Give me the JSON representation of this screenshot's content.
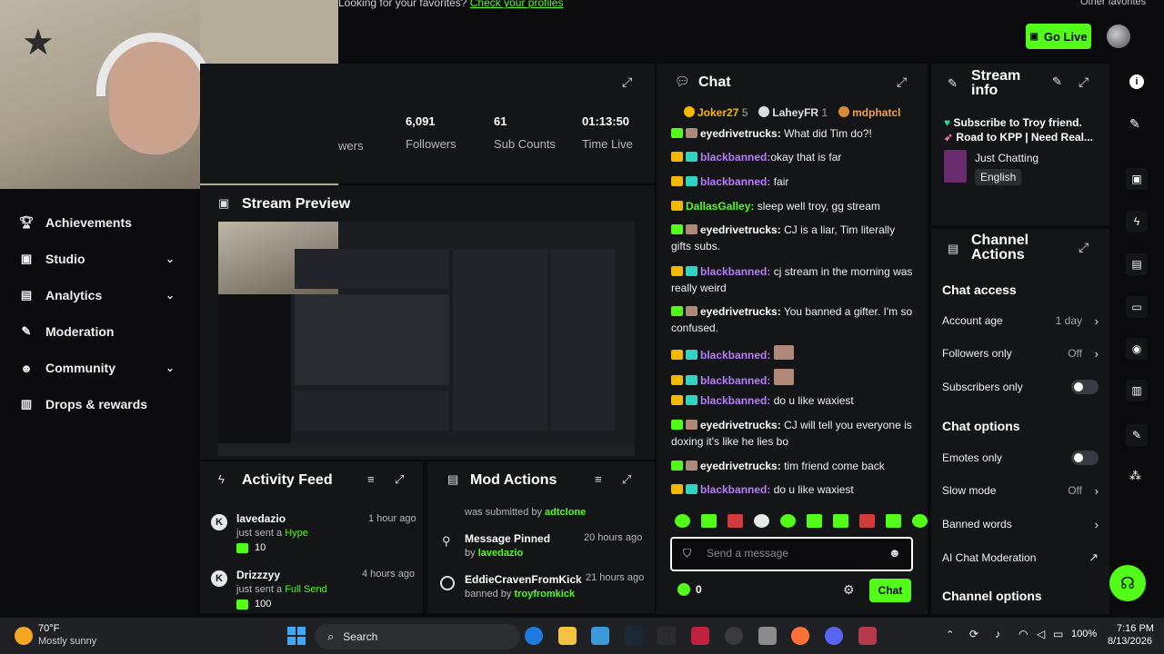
{
  "banner": {
    "text": "Looking for your favorites?",
    "link": "Check your profiles",
    "right_text": "Other favorites"
  },
  "topbar": {
    "go_live": "Go Live"
  },
  "sidebar": {
    "items": [
      {
        "label": "Achievements",
        "icon": "trophy-icon",
        "expandable": false
      },
      {
        "label": "Studio",
        "icon": "studio-icon",
        "expandable": true
      },
      {
        "label": "Analytics",
        "icon": "chart-icon",
        "expandable": true
      },
      {
        "label": "Moderation",
        "icon": "wrench-icon",
        "expandable": false
      },
      {
        "label": "Community",
        "icon": "users-icon",
        "expandable": true
      },
      {
        "label": "Drops & rewards",
        "icon": "gift-icon",
        "expandable": false
      }
    ]
  },
  "stats": {
    "items": [
      {
        "value": "",
        "label": "wers"
      },
      {
        "value": "6,091",
        "label": "Followers"
      },
      {
        "value": "61",
        "label": "Sub Counts"
      },
      {
        "value": "01:13:50",
        "label": "Time Live"
      }
    ]
  },
  "preview": {
    "title": "Stream Preview"
  },
  "activity": {
    "title": "Activity Feed",
    "items": [
      {
        "user": "lavedazio",
        "time": "1 hour ago",
        "action": "just sent a",
        "item": "Hype",
        "amount": "10"
      },
      {
        "user": "Drizzzyy",
        "time": "4 hours ago",
        "action": "just sent a",
        "item": "Full Send",
        "amount": "100"
      }
    ]
  },
  "modactions": {
    "title": "Mod Actions",
    "items": [
      {
        "title": "",
        "by_label": "was submitted by",
        "by": "adtclone",
        "time": ""
      },
      {
        "title": "Message Pinned",
        "by_label": "by",
        "by": "lavedazio",
        "time": "20 hours ago"
      },
      {
        "title": "EddieCravenFromKick",
        "by_label": "banned by",
        "by": "troyfromkick",
        "time": "21 hours ago"
      }
    ]
  },
  "chat": {
    "title": "Chat",
    "leaders": [
      {
        "name": "Joker27",
        "count": "5",
        "rank": "1"
      },
      {
        "name": "LaheyFR",
        "count": "1",
        "rank": "2"
      },
      {
        "name": "mdphatcl",
        "count": "",
        "rank": "3"
      }
    ],
    "messages": [
      {
        "user": "eyedrivetrucks:",
        "text": "What did Tim do?!"
      },
      {
        "user": "blackbanned:",
        "text": "okay that is far"
      },
      {
        "user": "blackbanned:",
        "text": "fair"
      },
      {
        "user": "DallasGalley:",
        "text": "sleep well troy, gg stream"
      },
      {
        "user": "eyedrivetrucks:",
        "text": "CJ is a liar, Tim literally gifts subs."
      },
      {
        "user": "blackbanned:",
        "text": "cj stream in the morning was really weird"
      },
      {
        "user": "eyedrivetrucks:",
        "text": "You banned a gifter. I'm so confused."
      },
      {
        "user": "blackbanned:",
        "text": ""
      },
      {
        "user": "blackbanned:",
        "text": ""
      },
      {
        "user": "blackbanned:",
        "text": "do u like waxiest"
      },
      {
        "user": "eyedrivetrucks:",
        "text": "CJ will tell you everyone is doxing it's like he lies bo"
      },
      {
        "user": "eyedrivetrucks:",
        "text": "tim friend come back"
      },
      {
        "user": "blackbanned:",
        "text": "do u like waxiest"
      }
    ],
    "input_placeholder": "Send a message",
    "points": "0",
    "send_label": "Chat"
  },
  "streaminfo": {
    "title": "Stream info",
    "stream_title_line1": "Subscribe to Troy friend.",
    "stream_title_line2": "Road to KPP | Need Real...",
    "category": "Just Chatting",
    "language": "English"
  },
  "channelactions": {
    "title": "Channel Actions",
    "chat_access": "Chat access",
    "account_age": {
      "label": "Account age",
      "value": "1 day"
    },
    "followers_only": {
      "label": "Followers only",
      "value": "Off"
    },
    "subscribers_only": {
      "label": "Subscribers only"
    },
    "chat_options": "Chat options",
    "emotes_only": {
      "label": "Emotes only"
    },
    "slow_mode": {
      "label": "Slow mode",
      "value": "Off"
    },
    "banned_words": {
      "label": "Banned words"
    },
    "ai_moderation": {
      "label": "AI Chat Moderation"
    },
    "channel_options": "Channel options"
  },
  "taskbar": {
    "weather_temp": "70°F",
    "weather_desc": "Mostly sunny",
    "search": "Search",
    "time": "7:16 PM",
    "date": "8/13/2026",
    "battery": "100%"
  },
  "colors": {
    "accent": "#53fc18",
    "panel": "#141517",
    "background": "#0b0b0d"
  }
}
